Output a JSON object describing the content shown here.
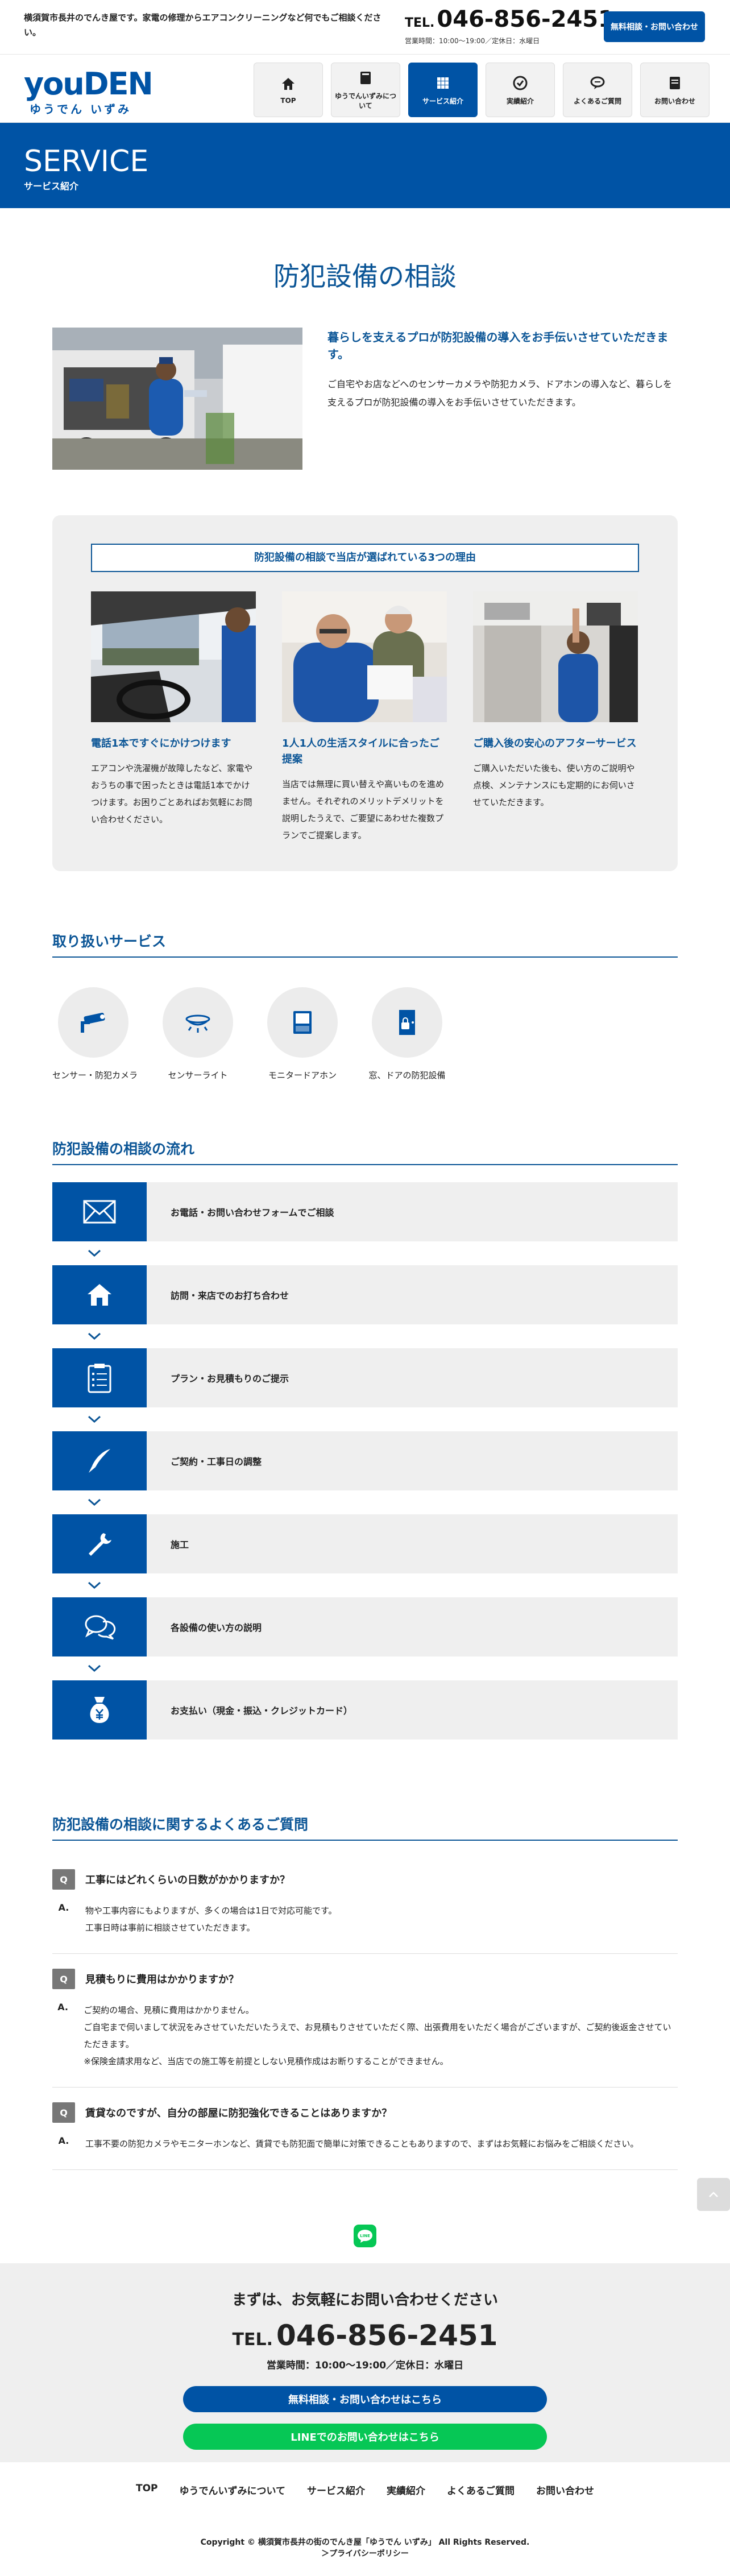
{
  "topbar": {
    "tagline": "横須賀市長井のでんき屋です。家電の修理からエアコンクリーニングなど何でもご相談ください。",
    "tel_prefix": "TEL.",
    "tel": "046-856-2451",
    "hours": "営業時間：10:00〜19:00／定休日：水曜日",
    "cta": "無料相談・お問い合わせ"
  },
  "logo": {
    "main": "youDEN",
    "sub": "ゆうでん いずみ"
  },
  "nav": [
    {
      "label": "TOP",
      "icon": "home-icon"
    },
    {
      "label": "ゆうでんいずみについて",
      "icon": "book-icon"
    },
    {
      "label": "サービス紹介",
      "icon": "grid-icon"
    },
    {
      "label": "実績紹介",
      "icon": "check-icon"
    },
    {
      "label": "よくあるご質問",
      "icon": "chat-icon"
    },
    {
      "label": "お問い合わせ",
      "icon": "doc-icon"
    }
  ],
  "banner": {
    "en": "SERVICE",
    "jp": "サービス紹介"
  },
  "page_title": "防犯設備の相談",
  "intro": {
    "lead": "暮らしを支えるプロが防犯設備の導入をお手伝いさせていただきます。",
    "text": "ご自宅やお店などへのセンサーカメラや防犯カメラ、ドアホンの導入など、暮らしを支えるプロが防犯設備の導入をお手伝いさせていただきます。"
  },
  "reasons": {
    "title": "防犯設備の相談で当店が選ばれている3つの理由",
    "items": [
      {
        "title": "電話1本ですぐにかけつけます",
        "text": "エアコンや洗濯機が故障したなど、家電やおうちの事で困ったときは電話1本でかけつけます。お困りごとあればお気軽にお問い合わせください。"
      },
      {
        "title": "1人1人の生活スタイルに合ったご提案",
        "text": "当店では無理に買い替えや高いものを進めません。それぞれのメリットデメリットを説明したうえで、ご要望にあわせた複数プランでご提案します。"
      },
      {
        "title": "ご購入後の安心のアフターサービス",
        "text": "ご購入いただいた後も、使い方のご説明や点検、メンテナンスにも定期的にお伺いさせていただきます。"
      }
    ]
  },
  "services": {
    "heading": "取り扱いサービス",
    "items": [
      {
        "name": "センサー・防犯カメラ",
        "icon": "camera-icon"
      },
      {
        "name": "センサーライト",
        "icon": "ceiling-light-icon"
      },
      {
        "name": "モニタードアホン",
        "icon": "intercom-icon"
      },
      {
        "name": "窓、ドアの防犯設備",
        "icon": "door-lock-icon"
      }
    ]
  },
  "flow": {
    "heading": "防犯設備の相談の流れ",
    "steps": [
      {
        "text": "お電話・お問い合わせフォームでご相談",
        "icon": "mail-icon"
      },
      {
        "text": "訪問・来店でのお打ち合わせ",
        "icon": "house-icon"
      },
      {
        "text": "プラン・お見積もりのご提示",
        "icon": "clipboard-icon"
      },
      {
        "text": "ご契約・工事日の調整",
        "icon": "pen-icon"
      },
      {
        "text": "施工",
        "icon": "wrench-icon"
      },
      {
        "text": "各設備の使い方の説明",
        "icon": "speech-bubbles-icon"
      },
      {
        "text": "お支払い（現金・振込・クレジットカード）",
        "icon": "money-bag-icon"
      }
    ]
  },
  "faq": {
    "heading": "防犯設備の相談に関するよくあるご質問",
    "q_mark": "Q",
    "a_mark": "A.",
    "items": [
      {
        "q": "工事にはどれくらいの日数がかかりますか？",
        "a": [
          "物や工事内容にもよりますが、多くの場合は1日で対応可能です。",
          "工事日時は事前に相談させていただきます。"
        ]
      },
      {
        "q": "見積もりに費用はかかりますか？",
        "a": [
          "ご契約の場合、見積に費用はかかりません。",
          "ご自宅まで伺いまして状況をみさせていただいたうえで、お見積もりさせていただく際、出張費用をいただく場合がございますが、ご契約後返金させていただきます。",
          "※保険金請求用など、当店での施工等を前提としない見積作成はお断りすることができません。"
        ]
      },
      {
        "q": "賃貸なのですが、自分の部屋に防犯強化できることはありますか？",
        "a": [
          "工事不要の防犯カメラやモニターホンなど、賃貸でも防犯面で簡単に対策できることもありますので、まずはお気軽にお悩みをご相談ください。"
        ]
      }
    ]
  },
  "contact": {
    "title": "まずは、お気軽にお問い合わせください",
    "tel_prefix": "TEL.",
    "tel": "046-856-2451",
    "hours": "営業時間：10:00〜19:00／定休日：水曜日",
    "btn_form": "無料相談・お問い合わせはこちら",
    "btn_line": "LINEでのお問い合わせはこちら"
  },
  "footer": {
    "nav": [
      "TOP",
      "ゆうでんいずみについて",
      "サービス紹介",
      "実績紹介",
      "よくあるご質問",
      "お問い合わせ"
    ],
    "copyright": "Copyright © 横須賀市長井の街のでんき屋「ゆうでん いずみ」 All Rights Reserved.",
    "privacy": "＞プライバシーポリシー"
  },
  "colors": {
    "primary": "#0053a5",
    "heading": "#0b5596",
    "line_green": "#06c755",
    "panel_gray": "#efefef"
  }
}
